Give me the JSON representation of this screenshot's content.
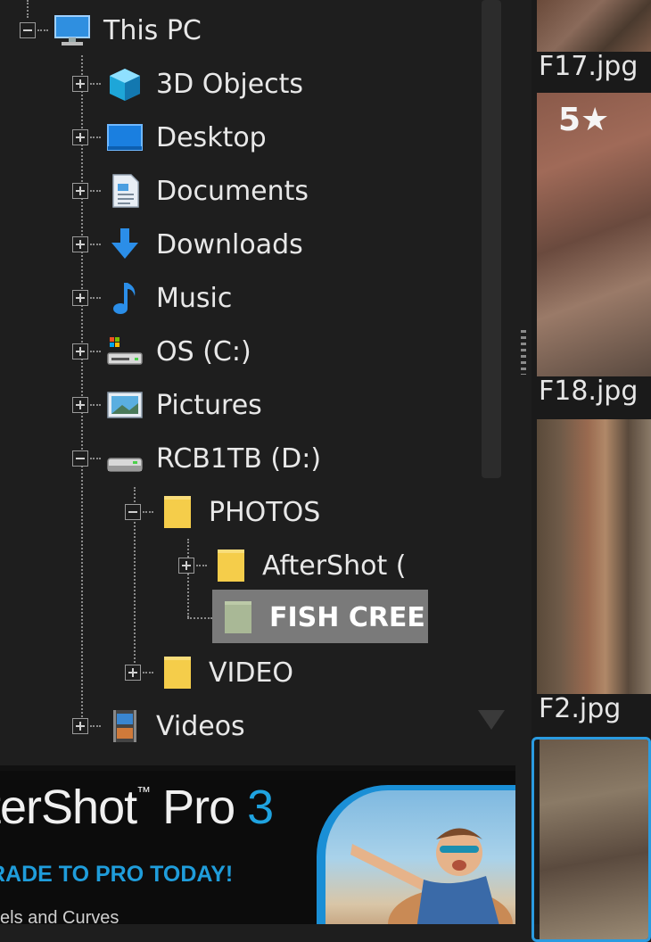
{
  "tree": {
    "items": [
      {
        "label": "This PC",
        "icon": "monitor-icon"
      },
      {
        "label": "3D Objects",
        "icon": "3d-objects-icon"
      },
      {
        "label": "Desktop",
        "icon": "desktop-icon"
      },
      {
        "label": "Documents",
        "icon": "documents-icon"
      },
      {
        "label": "Downloads",
        "icon": "downloads-icon"
      },
      {
        "label": "Music",
        "icon": "music-icon"
      },
      {
        "label": "OS (C:)",
        "icon": "drive-icon"
      },
      {
        "label": "Pictures",
        "icon": "pictures-icon"
      },
      {
        "label": "RCB1TB (D:)",
        "icon": "drive-icon"
      },
      {
        "label": "PHOTOS",
        "icon": "folder-icon"
      },
      {
        "label": "AfterShot (",
        "icon": "folder-icon"
      },
      {
        "label": "FISH CREE",
        "icon": "folder-icon",
        "selected": true
      },
      {
        "label": "VIDEO",
        "icon": "folder-icon"
      },
      {
        "label": "Videos",
        "icon": "videos-icon"
      }
    ]
  },
  "banner": {
    "title_main": "terShot",
    "title_tm": "™",
    "title_pro": " Pro ",
    "title_version": "3",
    "subtitle": "RADE TO PRO TODAY!",
    "small_text": "vels and Curves"
  },
  "thumbnails": [
    {
      "caption": "F17.jpg"
    },
    {
      "caption": "F18.jpg",
      "rating": "5★"
    },
    {
      "caption": "F2.jpg"
    },
    {
      "caption": ""
    }
  ],
  "colors": {
    "accent": "#2a9be0",
    "folder": "#f5cd4a",
    "selection": "#7a7a7a"
  }
}
